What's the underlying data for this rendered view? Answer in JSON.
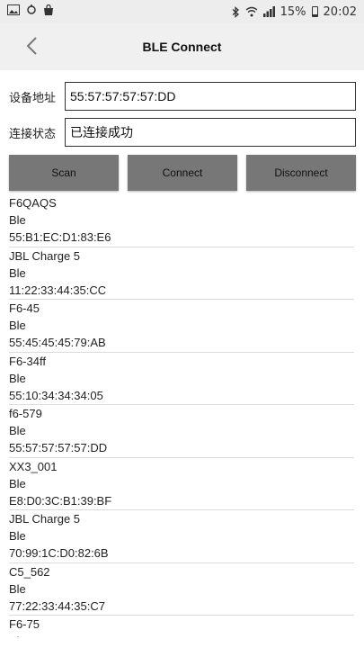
{
  "status_bar": {
    "battery": "15%",
    "time": "20:02"
  },
  "app_bar": {
    "title": "BLE Connect"
  },
  "fields": {
    "address_label": "设备地址",
    "address_value": "55:57:57:57:57:DD",
    "status_label": "连接状态",
    "status_value": "已连接成功"
  },
  "buttons": {
    "scan": "Scan",
    "connect": "Connect",
    "disconnect": "Disconnect"
  },
  "devices": [
    {
      "name": "F6QAQS",
      "type": "Ble",
      "address": "55:B1:EC:D1:83:E6"
    },
    {
      "name": "JBL Charge 5",
      "type": "Ble",
      "address": "11:22:33:44:35:CC"
    },
    {
      "name": "F6-45",
      "type": "Ble",
      "address": "55:45:45:45:79:AB"
    },
    {
      "name": "F6-34ff",
      "type": "Ble",
      "address": "55:10:34:34:34:05"
    },
    {
      "name": "f6-579",
      "type": "Ble",
      "address": "55:57:57:57:57:DD"
    },
    {
      "name": "XX3_001",
      "type": "Ble",
      "address": "E8:D0:3C:B1:39:BF"
    },
    {
      "name": "JBL Charge 5",
      "type": "Ble",
      "address": "70:99:1C:D0:82:6B"
    },
    {
      "name": "C5_562",
      "type": "Ble",
      "address": "77:22:33:44:35:C7"
    },
    {
      "name": "F6-75",
      "type": "Ble",
      "address": ""
    }
  ]
}
